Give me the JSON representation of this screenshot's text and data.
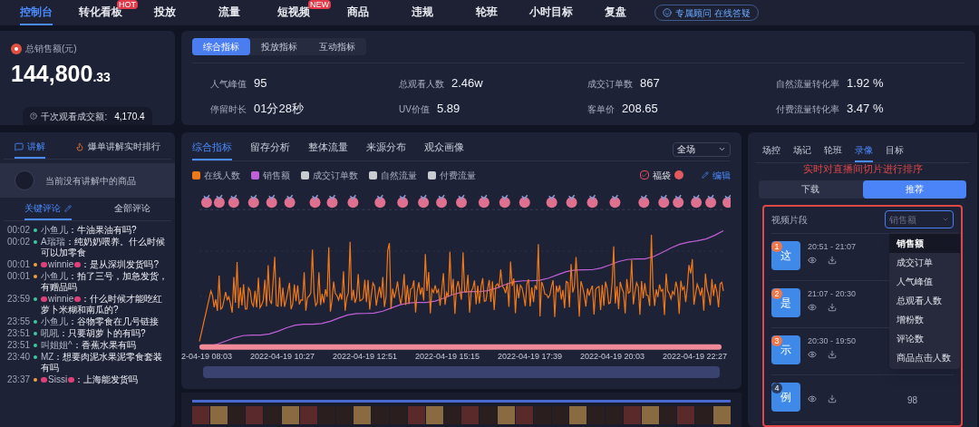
{
  "nav": {
    "items": [
      {
        "label": "控制台",
        "selected": true
      },
      {
        "label": "转化看板",
        "selected": false,
        "badge": "HOT"
      },
      {
        "label": "投放",
        "selected": false
      },
      {
        "label": "流量",
        "selected": false
      },
      {
        "label": "短视频",
        "selected": false,
        "badge": "NEW"
      },
      {
        "label": "商品",
        "selected": false
      },
      {
        "label": "违规",
        "selected": false
      },
      {
        "label": "轮班",
        "selected": false
      },
      {
        "label": "小时目标",
        "selected": false
      },
      {
        "label": "复盘",
        "selected": false
      }
    ],
    "advisor": "专属顾问 在线答疑"
  },
  "sales": {
    "label": "总销售额(元)",
    "value_main": "144,800",
    "value_decimal": ".33",
    "per_thousand_label": "千次观看成交额:",
    "per_thousand_value": "4,170.4"
  },
  "metrics": {
    "tabs": [
      {
        "label": "综合指标",
        "selected": true
      },
      {
        "label": "投放指标",
        "selected": false
      },
      {
        "label": "互动指标",
        "selected": false
      }
    ],
    "items": [
      {
        "label": "人气峰值",
        "value": "95"
      },
      {
        "label": "总观看人数",
        "value": "2.46w"
      },
      {
        "label": "成交订单数",
        "value": "867"
      },
      {
        "label": "自然流量转化率",
        "value": "1.92 %"
      },
      {
        "label": "停留时长",
        "value": "01分28秒"
      },
      {
        "label": "UV价值",
        "value": "5.89"
      },
      {
        "label": "客单价",
        "value": "208.65"
      },
      {
        "label": "付费流量转化率",
        "value": "3.47 %"
      }
    ]
  },
  "explain": {
    "tabs": [
      {
        "label": "讲解",
        "selected": true
      },
      {
        "label": "爆单讲解实时排行",
        "selected": false
      }
    ],
    "empty_text": "当前没有讲解中的商品",
    "comment_tabs": [
      {
        "label": "关键评论",
        "selected": true
      },
      {
        "label": "全部评论",
        "selected": false
      }
    ],
    "comments": [
      {
        "time": "00:02",
        "color": "#3ec7a0",
        "name": "小鱼儿",
        "text": "：牛油果油有吗?",
        "bows": false
      },
      {
        "time": "00:02",
        "color": "#3ec7a0",
        "name": "A瑞瑞",
        "text": "：纯奶奶喂养。什么时候可以加零食",
        "bows": false
      },
      {
        "time": "00:01",
        "color": "#f0a040",
        "name": "winnie",
        "text": "：是从深圳发货吗?",
        "bows": true
      },
      {
        "time": "00:01",
        "color": "#f0a040",
        "name": "小鱼儿",
        "text": "：拍了三号，加急发货，有赠品吗",
        "bows": false
      },
      {
        "time": "23:59",
        "color": "#3ec7a0",
        "name": "winnie",
        "text": "：什么时候才能吃红萝卜米糊和南瓜的?",
        "bows": true
      },
      {
        "time": "23:55",
        "color": "#3ec7a0",
        "name": "小鱼儿",
        "text": "：谷物零食在几号链接",
        "bows": false
      },
      {
        "time": "23:51",
        "color": "#3ec7a0",
        "name": "吼吼",
        "text": "：只要胡萝卜的有吗?",
        "bows": false
      },
      {
        "time": "23:51",
        "color": "#3ec7a0",
        "name": "叫姐姐^",
        "text": "：香蕉水果有吗",
        "bows": false
      },
      {
        "time": "23:40",
        "color": "#3ec7a0",
        "name": "MZ",
        "text": "：想要肉泥水果泥零食套装有吗",
        "bows": false
      },
      {
        "time": "23:37",
        "color": "#f0a040",
        "name": "Sissi",
        "text": "：上海能发货吗",
        "bows": true
      }
    ]
  },
  "trend": {
    "tabs": [
      {
        "label": "综合指标",
        "selected": true
      },
      {
        "label": "留存分析",
        "selected": false
      },
      {
        "label": "整体流量",
        "selected": false
      },
      {
        "label": "来源分布",
        "selected": false
      },
      {
        "label": "观众画像",
        "selected": false
      }
    ],
    "scope": "全场",
    "legend": [
      {
        "label": "在线人数",
        "color": "#f07818"
      },
      {
        "label": "销售额",
        "color": "#c060d8"
      },
      {
        "label": "成交订单数",
        "color": "#c8cbd0"
      },
      {
        "label": "自然流量",
        "color": "#c8cbd0"
      },
      {
        "label": "付费流量",
        "color": "#c8cbd0"
      }
    ],
    "lucky_bag": {
      "label": "福袋",
      "checked": true
    },
    "edit": "编辑",
    "x_labels": [
      "2-04-19 08:03",
      "2022-04-19 10:27",
      "2022-04-19 12:51",
      "2022-04-19 15:15",
      "2022-04-19 17:39",
      "2022-04-19 20:03",
      "2022-04-19 22:27"
    ]
  },
  "recording": {
    "tabs": [
      {
        "label": "场控",
        "selected": false
      },
      {
        "label": "场记",
        "selected": false
      },
      {
        "label": "轮班",
        "selected": false
      },
      {
        "label": "录像",
        "selected": true
      },
      {
        "label": "目标",
        "selected": false
      }
    ],
    "annotation": "实时对直播间切片进行排序",
    "modes": [
      {
        "label": "下载",
        "selected": false
      },
      {
        "label": "推荐",
        "selected": true
      }
    ],
    "section_label": "视频片段",
    "sort_placeholder": "销售额",
    "clips": [
      {
        "rank": "1",
        "char": "这",
        "time": "20:51 - 21:07"
      },
      {
        "rank": "2",
        "char": "是",
        "time": "21:07 - 20:30"
      },
      {
        "rank": "3",
        "char": "示",
        "time": "20:30 - 19:50"
      },
      {
        "rank": "4",
        "char": "例",
        "value": "98"
      }
    ],
    "sort_options": [
      {
        "label": "销售额",
        "selected": true
      },
      {
        "label": "成交订单",
        "selected": false
      },
      {
        "label": "人气峰值",
        "selected": false
      },
      {
        "label": "总观看人数",
        "selected": false
      },
      {
        "label": "增粉数",
        "selected": false
      },
      {
        "label": "评论数",
        "selected": false
      },
      {
        "label": "商品点击人数",
        "selected": false
      }
    ]
  }
}
